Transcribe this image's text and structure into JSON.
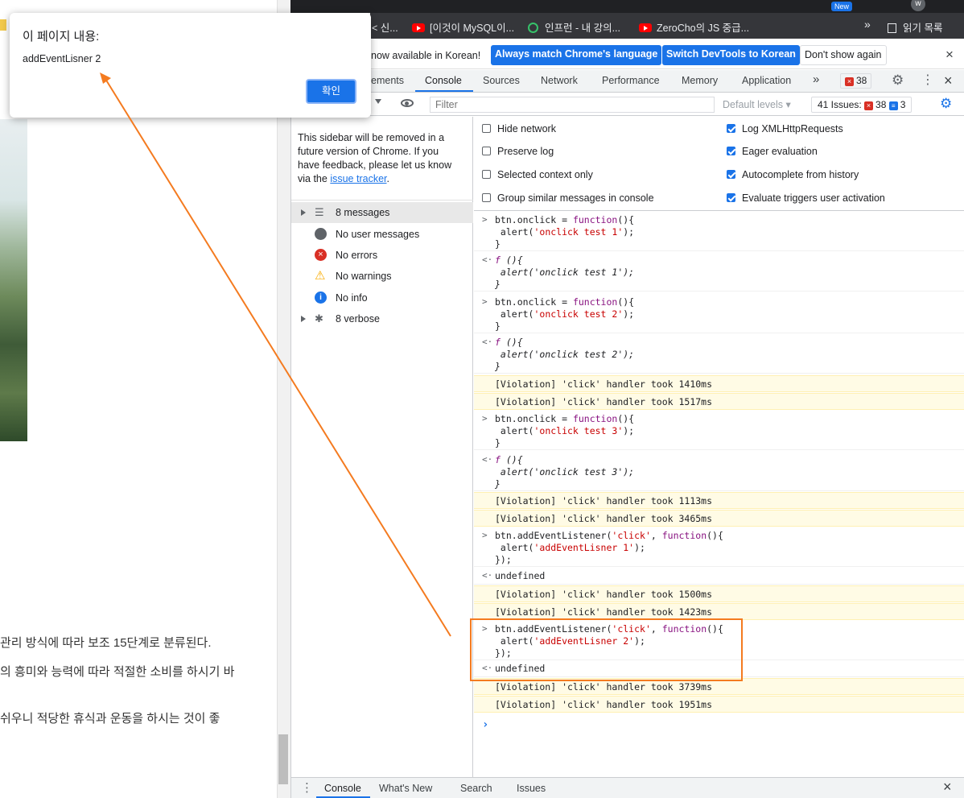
{
  "alert": {
    "title": "이 페이지 내용:",
    "message": "addEventLisner 2",
    "ok_label": "확인"
  },
  "bookmarks": [
    {
      "label": "< 신...",
      "icon": "bookmark-icon"
    },
    {
      "label": "[이것이 MySQL이...",
      "icon": "youtube-icon"
    },
    {
      "label": "인프런 - 내 강의...",
      "icon": "inflearn-icon"
    },
    {
      "label": "ZeroCho의 JS 중급...",
      "icon": "youtube-icon"
    },
    {
      "label": "»",
      "icon": "more-bookmarks-icon"
    },
    {
      "label": "읽기 목록",
      "icon": "reading-list-icon"
    }
  ],
  "webpage": {
    "lines": [
      "관리 방식에 따라 보조 15단계로 분류된다.",
      "의 흥미와 능력에 따라 적절한 소비를 하시기 바",
      "쉬우니 적당한 휴식과 운동을 하시는 것이 좋"
    ]
  },
  "infobar": {
    "text": "now available in Korean!",
    "btn_match": "Always match Chrome's language",
    "btn_switch": "Switch DevTools to Korean",
    "btn_dismiss": "Don't show again",
    "close": "×"
  },
  "tabs": {
    "elements": "ements",
    "console": "Console",
    "sources": "Sources",
    "network": "Network",
    "performance": "Performance",
    "memory": "Memory",
    "application": "Application",
    "more": "»",
    "error_count": "38"
  },
  "toolbar": {
    "filter_placeholder": "Filter",
    "levels": "Default levels",
    "issues_label": "41 Issues:",
    "issues_errors": "38",
    "issues_info": "3"
  },
  "sidebar": {
    "note": "This sidebar will be removed in a future version of Chrome. If you have feedback, please let us know via the",
    "link": "issue tracker",
    "note_end": ".",
    "items": [
      {
        "label": "8 messages"
      },
      {
        "label": "No user messages"
      },
      {
        "label": "No errors"
      },
      {
        "label": "No warnings"
      },
      {
        "label": "No info"
      },
      {
        "label": "8 verbose"
      }
    ]
  },
  "settings": {
    "hide_network": "Hide network",
    "preserve_log": "Preserve log",
    "selected_context": "Selected context only",
    "group_similar": "Group similar messages in console",
    "log_xhr": "Log XMLHttpRequests",
    "eager_eval": "Eager evaluation",
    "autocomplete": "Autocomplete from history",
    "eval_triggers": "Evaluate triggers user activation"
  },
  "console": {
    "c1": {
      "l1a": "btn.onclick = ",
      "l1b": "function",
      "l1c": "(){",
      "l2a": " alert(",
      "l2b": "'onclick test 1'",
      "l2c": ");",
      "l3": "}"
    },
    "r1": {
      "l1a": "f",
      "l1b": " (){",
      "l2": " alert('onclick test 1');",
      "l3": "}"
    },
    "c2": {
      "l1a": "btn.onclick = ",
      "l1b": "function",
      "l1c": "(){",
      "l2a": " alert(",
      "l2b": "'onclick test 2'",
      "l2c": ");",
      "l3": "}"
    },
    "r2": {
      "l1a": "f",
      "l1b": " (){",
      "l2": " alert('onclick test 2');",
      "l3": "}"
    },
    "v1": "[Violation] 'click' handler took 1410ms",
    "v2": "[Violation] 'click' handler took 1517ms",
    "c3": {
      "l1a": "btn.onclick = ",
      "l1b": "function",
      "l1c": "(){",
      "l2a": " alert(",
      "l2b": "'onclick test 3'",
      "l2c": ");",
      "l3": "}"
    },
    "r3": {
      "l1a": "f",
      "l1b": " (){",
      "l2": " alert('onclick test 3');",
      "l3": "}"
    },
    "v3": "[Violation] 'click' handler took 1113ms",
    "v4": "[Violation] 'click' handler took 3465ms",
    "c4": {
      "l1a": "btn.addEventListener(",
      "l1b": "'click'",
      "l1c": ", ",
      "l1d": "function",
      "l1e": "(){",
      "l2a": " alert(",
      "l2b": "'addEventLisner 1'",
      "l2c": ");",
      "l3": "});"
    },
    "u1": "undefined",
    "v5": "[Violation] 'click' handler took 1500ms",
    "v6": "[Violation] 'click' handler took 1423ms",
    "c5": {
      "l1a": "btn.addEventListener(",
      "l1b": "'click'",
      "l1c": ", ",
      "l1d": "function",
      "l1e": "(){",
      "l2a": " alert(",
      "l2b": "'addEventLisner 2'",
      "l2c": ");",
      "l3": "});"
    },
    "u2": "undefined",
    "v7": "[Violation] 'click' handler took 3739ms",
    "v8": "[Violation] 'click' handler took 1951ms"
  },
  "drawer": {
    "console": "Console",
    "whatsnew": "What's New",
    "search": "Search",
    "issues": "Issues",
    "close": "×"
  },
  "colors": {
    "accent": "#1a73e8",
    "violation_bg": "#fffbe5",
    "annotation": "#f47b20"
  }
}
